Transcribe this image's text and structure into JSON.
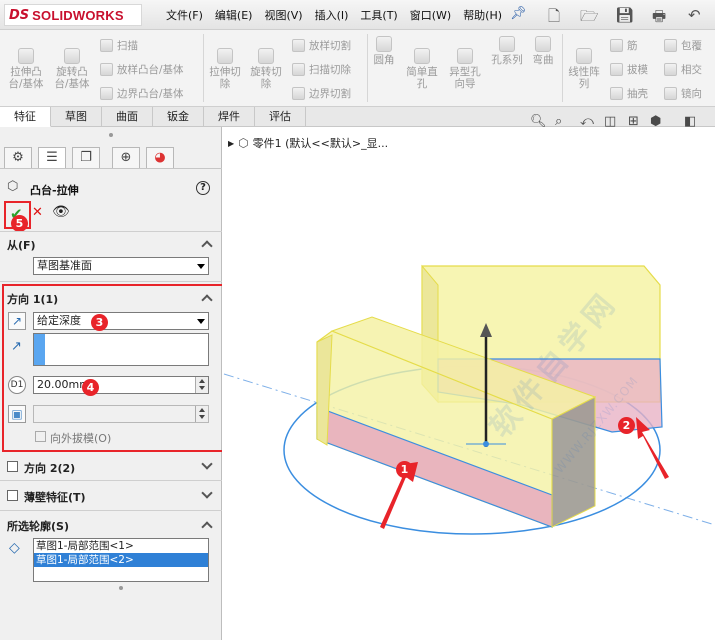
{
  "app": {
    "logo_mark": "DS",
    "logo_text": "SOLIDWORKS"
  },
  "menu": [
    "文件(F)",
    "编辑(E)",
    "视图(V)",
    "插入(I)",
    "工具(T)",
    "窗口(W)",
    "帮助(H)"
  ],
  "commands": {
    "extrude_boss": "拉伸凸\n台/基体",
    "revolve_boss": "旋转凸\n台/基体",
    "sweep": "扫描",
    "loft_boss": "放样凸台/基体",
    "boundary_boss": "边界凸台/基体",
    "extrude_cut": "拉伸切\n除",
    "revolve_cut": "旋转切\n除",
    "loft_cut": "放样切割",
    "swept_cut": "扫描切除",
    "boundary_cut": "边界切割",
    "fillet": "圆角",
    "hole_wizard_simple": "简单直\n孔",
    "hole_wizard": "异型孔\n向导",
    "hole_series": "孔系列",
    "flex": "弯曲",
    "linear_pattern": "线性阵\n列",
    "rib": "筋",
    "draft": "拔模",
    "shell": "抽壳",
    "wrap": "包覆",
    "intersect": "相交",
    "mirror": "镜向"
  },
  "tabs": [
    "特征",
    "草图",
    "曲面",
    "钣金",
    "焊件",
    "评估"
  ],
  "active_tab": "特征",
  "property_manager": {
    "feature_title": "凸台-拉伸",
    "help_symbol": "?",
    "ok_symbol": "✔",
    "cancel_symbol": "✕",
    "from": {
      "label": "从(F)",
      "value": "草图基准面"
    },
    "direction1": {
      "label": "方向 1(1)",
      "end_condition": "给定深度",
      "depth": "20.00mm",
      "draft_outward": "向外拔模(O)",
      "depth_symbol": "D1"
    },
    "direction2": {
      "label": "方向 2(2)"
    },
    "thin_feature": {
      "label": "薄壁特征(T)"
    },
    "selected_contours": {
      "label": "所选轮廓(S)",
      "items": [
        "草图1-局部范围<1>",
        "草图1-局部范围<2>"
      ],
      "selected_index": 1
    }
  },
  "feature_tree": {
    "root": "零件1  (默认<<默认>_显..."
  },
  "annotations": {
    "badges": [
      "1",
      "2",
      "3",
      "4",
      "5"
    ]
  },
  "watermark": {
    "main": "软件自学网",
    "sub": "WWW.RJZXW.COM"
  },
  "colors": {
    "accent_red": "#e8242a",
    "model_yellow": "#f3f09a",
    "model_pink": "#e4a9bf",
    "edge_blue": "#3b8ee0",
    "selection_blue": "#2f80d6"
  }
}
